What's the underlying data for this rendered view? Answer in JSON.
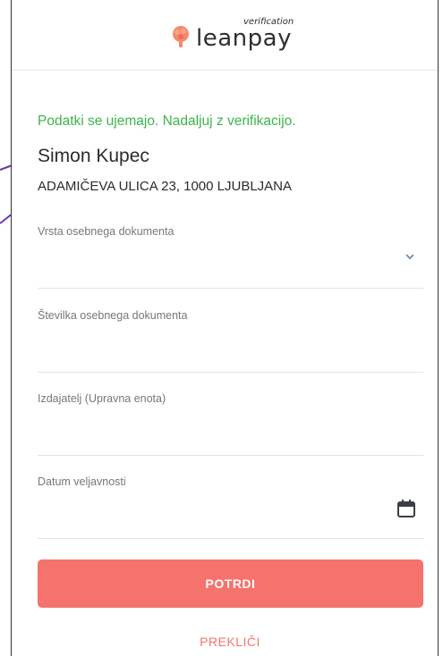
{
  "header": {
    "logo_text": "leanpay",
    "logo_subtext": "verification"
  },
  "status_message": "Podatki se ujemajo. Nadaljuj z verifikacijo.",
  "user": {
    "name": "Simon Kupec",
    "address": "ADAMIČEVA ULICA 23, 1000 LJUBLJANA"
  },
  "fields": [
    {
      "label": "Vrsta osebnega dokumenta",
      "value": "",
      "icon": "chevron-down-icon"
    },
    {
      "label": "Številka osebnega dokumenta",
      "value": ""
    },
    {
      "label": "Izdajatelj (Upravna enota)",
      "value": ""
    },
    {
      "label": "Datum veljavnosti",
      "value": "",
      "icon": "calendar-icon"
    }
  ],
  "buttons": {
    "confirm": "POTRDI",
    "cancel": "PREKLIČI"
  },
  "colors": {
    "accent": "#f5736c",
    "success": "#3cb54a",
    "arrow": "#6a3aa8"
  }
}
